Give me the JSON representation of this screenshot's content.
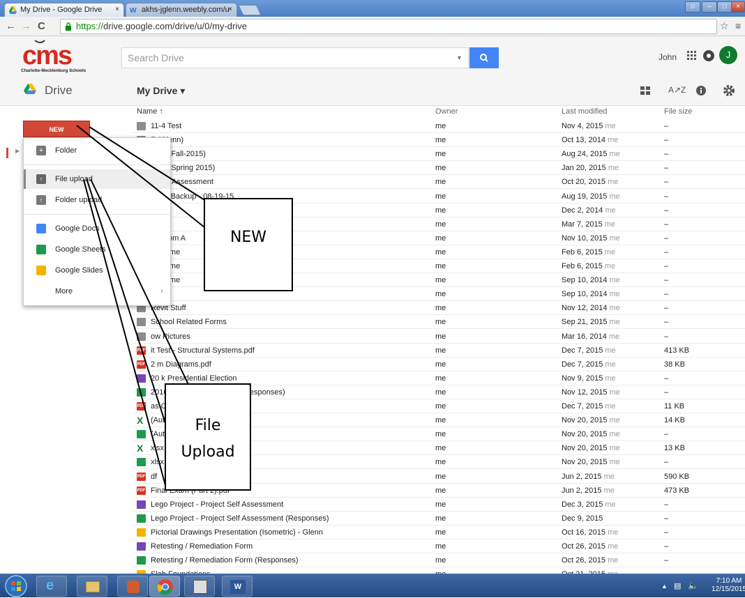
{
  "browser": {
    "tabs": [
      {
        "label": "My Drive - Google Drive",
        "close": "×"
      },
      {
        "label": "akhs-jglenn.weebly.com/u",
        "close": "×"
      }
    ],
    "url_scheme": "https://",
    "url_rest": "drive.google.com/drive/u/0/my-drive"
  },
  "header": {
    "logo_text": "cms",
    "logo_subtitle": "Charlotte-Mecklenburg Schools",
    "search_placeholder": "Search Drive",
    "user_name": "John",
    "avatar_letter": "J"
  },
  "subheader": {
    "app_title": "Drive",
    "location": "My Drive ▾"
  },
  "sidebar": {
    "new_label": "NEW"
  },
  "new_menu": {
    "items": [
      {
        "label": "Folder",
        "icon": "folder-plus-icon"
      },
      {
        "label": "File upload",
        "icon": "file-upload-icon"
      },
      {
        "label": "Folder upload",
        "icon": "folder-upload-icon"
      },
      {
        "label": "Google Docs",
        "icon": "docs-icon"
      },
      {
        "label": "Google Sheets",
        "icon": "sheets-icon"
      },
      {
        "label": "Google Slides",
        "icon": "slides-icon"
      },
      {
        "label": "More",
        "icon": "chevron-right-icon",
        "arrow": "›"
      }
    ]
  },
  "columns": {
    "name": "Name ↑",
    "owner": "Owner",
    "modified": "Last modified",
    "size": "File size"
  },
  "files": [
    {
      "name": "11-4 Test",
      "type": "folder",
      "owner": "me",
      "date": "Nov 4, 2015",
      "by": "me",
      "size": "–"
    },
    {
      "name": "E (Glenn)",
      "type": "folder",
      "owner": "me",
      "date": "Oct 13, 2014",
      "by": "me",
      "size": "–"
    },
    {
      "name": "sses (Fall-2015)",
      "type": "folder",
      "owner": "me",
      "date": "Aug 24, 2015",
      "by": "me",
      "size": "–"
    },
    {
      "name": "sses (Spring 2015)",
      "type": "folder",
      "owner": "me",
      "date": "Jan 20, 2015",
      "by": "me",
      "size": "–"
    },
    {
      "name": "y Self Assessment",
      "type": "folder",
      "owner": "me",
      "date": "Oct 20, 2015",
      "by": "me",
      "size": "–"
    },
    {
      "name": "Drive Backup - 08-19-15",
      "type": "folder",
      "owner": "me",
      "date": "Aug 19, 2015",
      "by": "me",
      "size": "–"
    },
    {
      "name": "",
      "type": "folder",
      "owner": "me",
      "date": "Dec 2, 2014",
      "by": "me",
      "size": "–"
    },
    {
      "name": "ogle",
      "type": "folder",
      "owner": "me",
      "date": "Mar 7, 2015",
      "by": "me",
      "size": "–"
    },
    {
      "name": "meroom A",
      "type": "folder",
      "owner": "me",
      "date": "Nov 10, 2015",
      "by": "me",
      "size": "–"
    },
    {
      "name": "ght Time",
      "type": "folder",
      "owner": "me",
      "date": "Feb 6, 2015",
      "by": "me",
      "size": "–"
    },
    {
      "name": "ght Time",
      "type": "folder",
      "owner": "me",
      "date": "Feb 6, 2015",
      "by": "me",
      "size": "–"
    },
    {
      "name": "ght Time",
      "type": "folder",
      "owner": "me",
      "date": "Sep 10, 2014",
      "by": "me",
      "size": "–"
    },
    {
      "name": "Drive",
      "type": "folder",
      "owner": "me",
      "date": "Sep 10, 2014",
      "by": "me",
      "size": "–"
    },
    {
      "name": "Revit Stuff",
      "type": "folder",
      "owner": "me",
      "date": "Nov 12, 2014",
      "by": "me",
      "size": "–"
    },
    {
      "name": "School Related Forms",
      "type": "folder",
      "owner": "me",
      "date": "Sep 21, 2015",
      "by": "me",
      "size": "–"
    },
    {
      "name": "ow Pictures",
      "type": "folder",
      "owner": "me",
      "date": "Mar 16, 2014",
      "by": "me",
      "size": "–"
    },
    {
      "name": "it Test - Structural Systems.pdf",
      "type": "pdf",
      "owner": "me",
      "date": "Dec 7, 2015",
      "by": "me",
      "size": "413 KB"
    },
    {
      "name": "2 m Diagrams.pdf",
      "type": "pdf",
      "owner": "me",
      "date": "Dec 7, 2015",
      "by": "me",
      "size": "38 KB"
    },
    {
      "name": "20 k Presidential Election",
      "type": "form",
      "owner": "me",
      "date": "Nov 9, 2015",
      "by": "me",
      "size": "–"
    },
    {
      "name": "2016 Presidential Election (Responses)",
      "type": "sheet",
      "owner": "me",
      "date": "Nov 12, 2015",
      "by": "me",
      "size": "–"
    },
    {
      "name": "as Chart.pdf",
      "type": "pdf",
      "owner": "me",
      "date": "Dec 7, 2015",
      "by": "me",
      "size": "11 KB"
    },
    {
      "name": "(Automatic).xlsx",
      "type": "excel",
      "owner": "me",
      "date": "Nov 20, 2015",
      "by": "me",
      "size": "14 KB"
    },
    {
      "name": "(Automatic).xlsx",
      "type": "sheet",
      "owner": "me",
      "date": "Nov 20, 2015",
      "by": "me",
      "size": "–"
    },
    {
      "name": "xlsx",
      "type": "excel",
      "owner": "me",
      "date": "Nov 20, 2015",
      "by": "me",
      "size": "13 KB"
    },
    {
      "name": "xlsx",
      "type": "sheet",
      "owner": "me",
      "date": "Nov 20, 2015",
      "by": "me",
      "size": "–"
    },
    {
      "name": "df",
      "type": "pdf",
      "owner": "me",
      "date": "Jun 2, 2015",
      "by": "me",
      "size": "590 KB"
    },
    {
      "name": "Final Exam (Part 2).pdf",
      "type": "pdf",
      "owner": "me",
      "date": "Jun 2, 2015",
      "by": "me",
      "size": "473 KB"
    },
    {
      "name": "Lego Project - Project Self Assessment",
      "type": "form",
      "owner": "me",
      "date": "Dec 3, 2015",
      "by": "me",
      "size": "–"
    },
    {
      "name": "Lego Project - Project Self Assessment (Responses)",
      "type": "sheet",
      "owner": "me",
      "date": "Dec 9, 2015",
      "by": "",
      "size": "–"
    },
    {
      "name": "Pictorial Drawings Presentation (Isometric) - Glenn",
      "type": "slide",
      "owner": "me",
      "date": "Oct 16, 2015",
      "by": "me",
      "size": "–"
    },
    {
      "name": "Retesting / Remediation Form",
      "type": "form",
      "owner": "me",
      "date": "Oct 26, 2015",
      "by": "me",
      "size": "–"
    },
    {
      "name": "Retesting / Remediation Form (Responses)",
      "type": "sheet",
      "owner": "me",
      "date": "Oct 26, 2015",
      "by": "me",
      "size": "–"
    },
    {
      "name": "Slab Foundations",
      "type": "slide",
      "owner": "me",
      "date": "Oct 21, 2015",
      "by": "me",
      "size": "–"
    }
  ],
  "callouts": {
    "new": "NEW",
    "upload_line1": "File",
    "upload_line2": "Upload"
  },
  "taskbar": {
    "time": "7:10 AM",
    "date": "12/15/2015"
  }
}
